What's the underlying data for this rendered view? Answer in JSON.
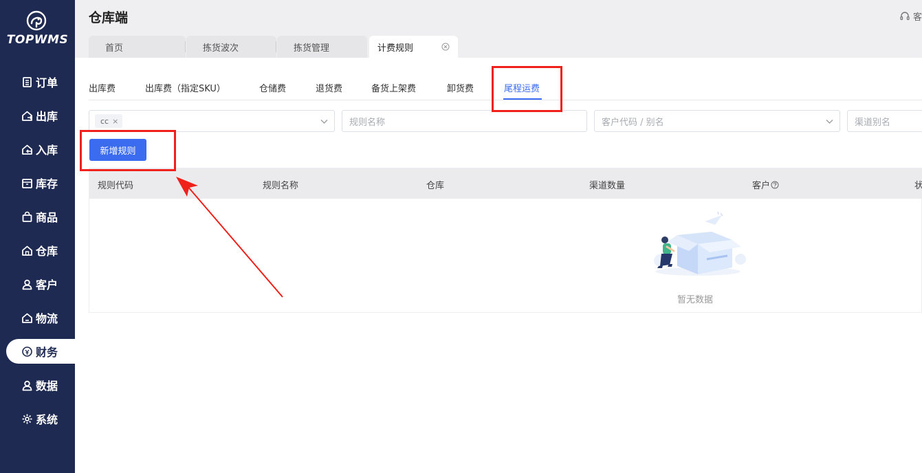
{
  "brand": {
    "name": "TOPWMS",
    "logo_icon": "elephant-logo-icon"
  },
  "sidebar": {
    "items": [
      {
        "label": "订单",
        "icon": "document-icon"
      },
      {
        "label": "出库",
        "icon": "outbound-icon"
      },
      {
        "label": "入库",
        "icon": "inbound-icon"
      },
      {
        "label": "库存",
        "icon": "inventory-icon"
      },
      {
        "label": "商品",
        "icon": "bag-icon"
      },
      {
        "label": "仓库",
        "icon": "warehouse-icon"
      },
      {
        "label": "客户",
        "icon": "user-icon"
      },
      {
        "label": "物流",
        "icon": "logistics-icon"
      },
      {
        "label": "财务",
        "icon": "finance-icon",
        "active": true
      },
      {
        "label": "数据",
        "icon": "data-icon"
      },
      {
        "label": "系统",
        "icon": "gear-icon"
      }
    ]
  },
  "header": {
    "title": "仓库端",
    "right_label": "客",
    "page_tabs": [
      {
        "label": "首页"
      },
      {
        "label": "拣货波次"
      },
      {
        "label": "拣货管理"
      },
      {
        "label": "计费规则",
        "active": true,
        "closable": true
      }
    ]
  },
  "subtabs": [
    {
      "label": "出库费"
    },
    {
      "label": "出库费（指定SKU）"
    },
    {
      "label": "仓储费"
    },
    {
      "label": "退货费"
    },
    {
      "label": "备货上架费"
    },
    {
      "label": "卸货费"
    },
    {
      "label": "尾程运费",
      "active": true
    }
  ],
  "filters": {
    "warehouse_tag": "cc",
    "rule_name_placeholder": "规则名称",
    "customer_placeholder": "客户代码 / 别名",
    "channel_placeholder": "渠道别名"
  },
  "actions": {
    "add_rule": "新增规则"
  },
  "table": {
    "columns": [
      "规则代码",
      "规则名称",
      "仓库",
      "渠道数量",
      "客户",
      "状"
    ],
    "empty_text": "暂无数据"
  },
  "colors": {
    "sidebar_bg": "#1f2a52",
    "primary": "#3b6cf0",
    "annotation_red": "#f0201a"
  }
}
